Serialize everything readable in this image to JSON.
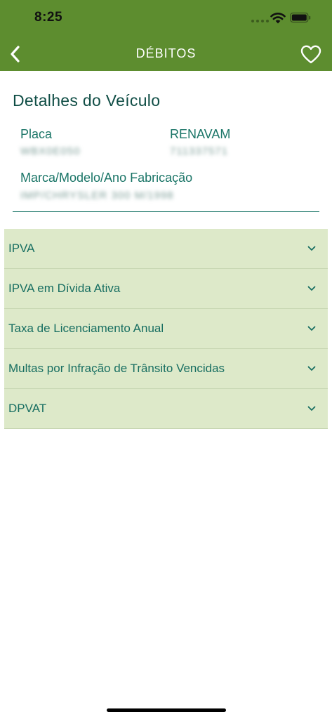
{
  "status_bar": {
    "time": "8:25"
  },
  "nav": {
    "title": "DÉBITOS",
    "back_icon": "chevron-left-icon",
    "favorite_icon": "heart-outline-icon"
  },
  "vehicle": {
    "section_title": "Detalhes do Veículo",
    "plate_label": "Placa",
    "plate_value": "WBX0E050",
    "renavam_label": "RENAVAM",
    "renavam_value": "711337571",
    "model_label": "Marca/Modelo/Ano Fabricação",
    "model_value": "IMP/CHRYSLER 300 M/1998"
  },
  "debts": {
    "items": [
      {
        "label": "IPVA"
      },
      {
        "label": "IPVA em Dívida Ativa"
      },
      {
        "label": "Taxa de Licenciamento Anual"
      },
      {
        "label": "Multas por Infração de Trânsito Vencidas"
      },
      {
        "label": "DPVAT"
      }
    ],
    "chevron_icon": "chevron-down-icon"
  },
  "colors": {
    "header_green": "#5d8d2f",
    "accent_teal": "#1a7567",
    "accordion_bg": "#dde9c9"
  }
}
